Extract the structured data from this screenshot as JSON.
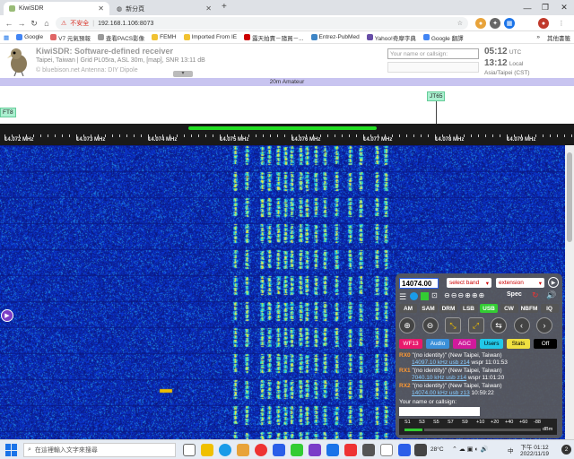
{
  "browser": {
    "tabs": [
      {
        "title": "KiwiSDR",
        "active": true
      },
      {
        "title": "新分頁",
        "active": false
      }
    ],
    "new_tab": "+",
    "window_controls": [
      "—",
      "❐",
      "✕"
    ],
    "address_warning": "不安全",
    "url": "192.168.1.106:8073",
    "bookmarks": [
      {
        "label": "Google",
        "color": "#4285f4"
      },
      {
        "label": "V7 元氣預報",
        "color": "#e06666"
      },
      {
        "label": "查看PACS影像",
        "color": "#999999"
      },
      {
        "label": "FEMH",
        "color": "#f1c232"
      },
      {
        "label": "Imported From IE",
        "color": "#f1c232"
      },
      {
        "label": "露天拍賣－隨買－...",
        "color": "#cc0000"
      },
      {
        "label": "Entrez-PubMed",
        "color": "#3d85c6"
      },
      {
        "label": "Yahoo!奇摩字典",
        "color": "#674ea7"
      },
      {
        "label": "Google 翻譯",
        "color": "#4285f4"
      }
    ],
    "bookmarks_more": "»",
    "other_bookmarks": "其他書籤"
  },
  "kiwi": {
    "title": "KiwiSDR: Software-defined receiver",
    "location": "Taipei, Taiwan | Grid PL05ra, ASL 30m, [map], SNR 13:11 dB",
    "antenna": "© bluebison.net Antenna: DIY Dipole",
    "name_placeholder": "Your name or callsign:",
    "utc_time": "05:12",
    "utc_label": "UTC",
    "local_time": "13:12",
    "local_label": "Local",
    "timezone": "Asia/Taipei (CST)",
    "collapse": "▾"
  },
  "band": {
    "name": "20m Amateur",
    "dx_labels": [
      {
        "label": "FT8",
        "pos": 0.0
      },
      {
        "label": "JT65",
        "pos": 0.76
      }
    ]
  },
  "scale": {
    "ticks": [
      "14.072 MHz",
      "14.073 MHz",
      "14.074 MHz",
      "14.075 MHz",
      "14.076 MHz",
      "14.077 MHz",
      "14.078 MHz",
      "14.079 MHz"
    ]
  },
  "panel": {
    "frequency": "14074.00",
    "band_select": "select band",
    "extension_select": "extension",
    "spec_label": "Spec",
    "modes": [
      {
        "label": "AM",
        "on": false
      },
      {
        "label": "SAM",
        "on": false
      },
      {
        "label": "DRM",
        "on": false
      },
      {
        "label": "LSB",
        "on": false
      },
      {
        "label": "USB",
        "on": true
      },
      {
        "label": "CW",
        "on": false
      },
      {
        "label": "NBFM",
        "on": false
      },
      {
        "label": "IQ",
        "on": false
      }
    ],
    "zoom_icons": [
      "zoom-in",
      "zoom-out",
      "zoom-fit",
      "zoom-max",
      "swap",
      "step-left",
      "step-right"
    ],
    "tabs": [
      {
        "label": "WF13",
        "bg": "#e8186c",
        "fg": "#ffffff"
      },
      {
        "label": "Audio",
        "bg": "#3a8fd8",
        "fg": "#ffffff"
      },
      {
        "label": "AGC",
        "bg": "#d01a9c",
        "fg": "#ffffff"
      },
      {
        "label": "Users",
        "bg": "#22c8e8",
        "fg": "#000000"
      },
      {
        "label": "Stats",
        "bg": "#f0e040",
        "fg": "#000000"
      },
      {
        "label": "Off",
        "bg": "#000000",
        "fg": "#ffffff"
      }
    ],
    "users": [
      {
        "tag": "RX0",
        "name": "\"(no identity)\" (New Taipei, Taiwan)",
        "link": "14097.10 kHz usb z14",
        "extra": "wspr 11:01:53"
      },
      {
        "tag": "RX1",
        "name": "\"(no identity)\" (New Taipei, Taiwan)",
        "link": "7040.10 kHz usb z14",
        "extra": "wspr 11:01:20"
      },
      {
        "tag": "RX2",
        "name": "\"(no identity)\" (New Taipei, Taiwan)",
        "link": "14074.00 kHz usb z13",
        "extra": "10:59:22"
      }
    ],
    "name_label": "Your name or callsign:",
    "smeter": [
      "S1",
      "S3",
      "S5",
      "S7",
      "S9",
      "+10",
      "+20",
      "+40",
      "+60",
      "-88"
    ],
    "smeter_unit": "dBm"
  },
  "taskbar": {
    "search_placeholder": "在這裡輸入文字來搜尋",
    "temperature": "28°C",
    "time": "下午 01:12",
    "date": "2022/11/19",
    "lang": "中",
    "notif": "2"
  }
}
